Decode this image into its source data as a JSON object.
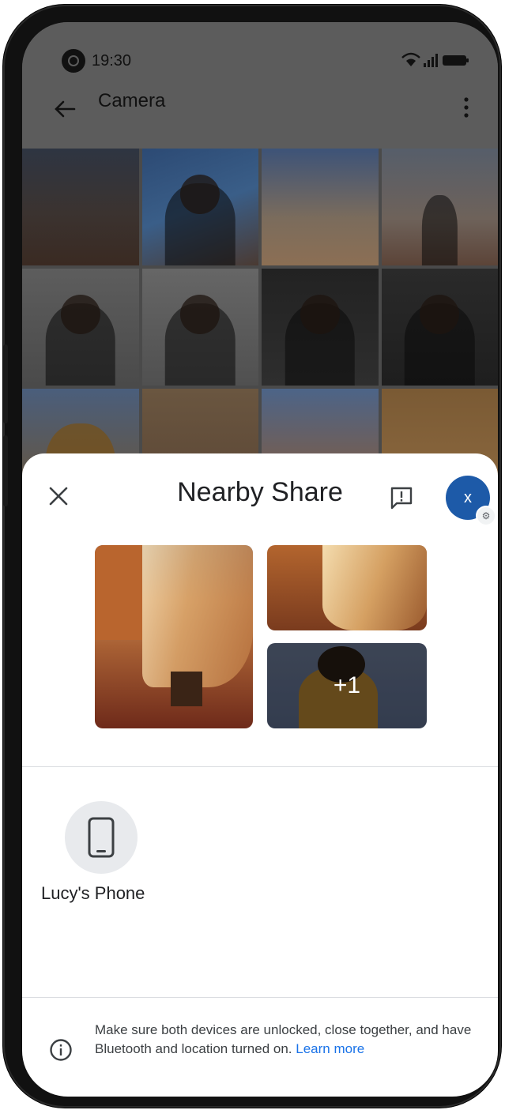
{
  "status_bar": {
    "time": "19:30"
  },
  "app_bar": {
    "title": "Camera"
  },
  "gallery": {
    "tiles": [
      "landscape-dusk",
      "portrait-woman",
      "monk-tower",
      "monk-standing",
      "profile-man",
      "portrait-man",
      "young-man-1",
      "young-man-2",
      "woman-profile",
      "studio-lamp",
      "curtain-1",
      "curtain-2"
    ]
  },
  "sheet": {
    "title": "Nearby Share",
    "avatar_initial": "x",
    "previews": {
      "more_count": "+1"
    },
    "devices": [
      {
        "name": "Lucy's Phone"
      }
    ],
    "info": {
      "message": "Make sure both devices are unlocked, close together, and have Bluetooth and location turned on.",
      "learn_more": "Learn more"
    }
  },
  "colors": {
    "accent_blue": "#1a73e8",
    "avatar_bg": "#1d5aa8",
    "scrim": "#5c5c5c"
  }
}
